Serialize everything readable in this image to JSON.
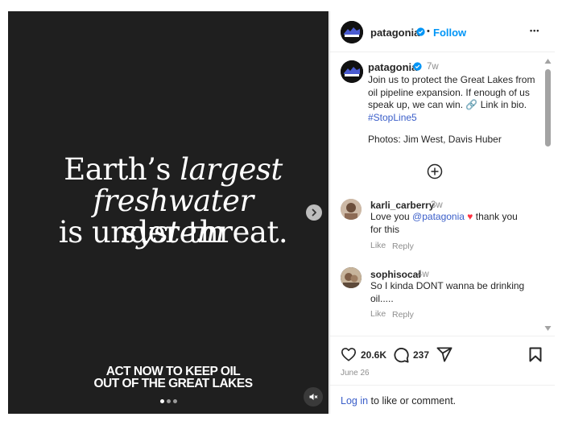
{
  "media": {
    "headline": [
      "Earth’s",
      "largest",
      "freshwater system",
      "is under threat."
    ],
    "cta": [
      "ACT NOW TO KEEP OIL",
      "OUT OF THE GREAT LAKES"
    ],
    "carousel_index": 1,
    "carousel_total": 3
  },
  "header": {
    "username": "patagonia",
    "dot": "•",
    "follow": "Follow",
    "more": "•••"
  },
  "caption": {
    "username": "patagonia",
    "time": "7w",
    "lines": [
      "Join us to protect the Great Lakes from",
      "oil pipeline expansion. If enough of us",
      "speak up, we can win."
    ],
    "link_text": "Link in bio.",
    "hashtag": "#StopLine5",
    "photos": "Photos: Jim West, Davis Huber"
  },
  "comments": [
    {
      "username": "karli_carberry",
      "time": "3w",
      "text_pre": "Love you ",
      "mention": "@patagonia",
      "text_post": " thank you",
      "text_line2": "for this",
      "like": "Like",
      "reply": "Reply"
    },
    {
      "username": "sophisocal",
      "time": "4w",
      "text_line1": "So I kinda DONT wanna be drinking",
      "text_line2": "oil.....",
      "like": "Like",
      "reply": "Reply"
    }
  ],
  "actions": {
    "likes": "20.6K",
    "comments": "237"
  },
  "date": "June 26",
  "login": {
    "link": "Log in",
    "rest": "to like or comment."
  },
  "colors": {
    "accent": "#0095f6",
    "verified": "#0095f6",
    "heart": "#ff3040",
    "media_bg": "#1f1f1f"
  },
  "icons": [
    "verified-badge-icon",
    "more-icon",
    "add-circle-icon",
    "heart-icon",
    "comment-icon",
    "share-icon",
    "bookmark-icon",
    "chevron-right-icon",
    "mute-icon",
    "link-icon"
  ]
}
